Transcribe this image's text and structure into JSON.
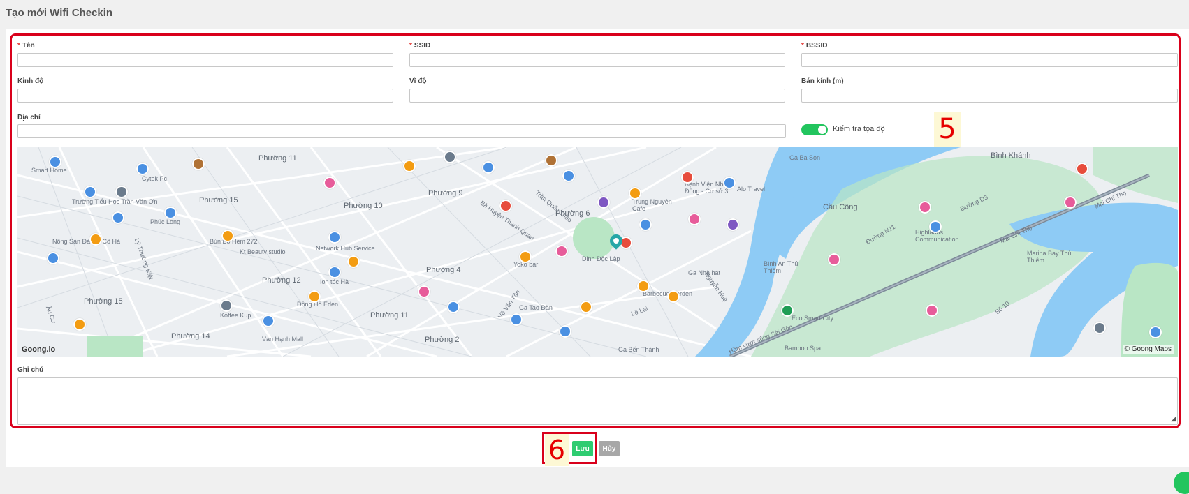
{
  "page": {
    "title": "Tạo mới Wifi Checkin"
  },
  "form": {
    "name_label": "Tên",
    "ssid_label": "SSID",
    "bssid_label": "BSSID",
    "longitude_label": "Kinh độ",
    "latitude_label": "Vĩ độ",
    "radius_label": "Bán kính (m)",
    "address_label": "Địa chỉ",
    "check_coords_label": "Kiểm tra tọa độ",
    "check_coords_enabled": true,
    "note_label": "Ghi chú"
  },
  "annotations": {
    "form_marker": "5",
    "save_marker": "6"
  },
  "map": {
    "attribution_left": "Goong.io",
    "attribution_right": "© Goong Maps",
    "labels": {
      "phuong11_top": "Phường 11",
      "phuong15_a": "Phường 15",
      "phuong10_a": "Phường 10",
      "phuong9": "Phường 9",
      "phuong6": "Phường 6",
      "phuong4": "Phường 4",
      "phuong12": "Phường 12",
      "phuong15_b": "Phường 15",
      "phuong11_b": "Phường 11",
      "phuong2": "Phường 2",
      "phuong14": "Phường 14",
      "cau_cong": "Cầu Công",
      "binh_khanh": "Bình Khánh",
      "dinh_doc_lap": "Dinh Độc Lập",
      "mai_chi_tho_a": "Mai Chí Thọ",
      "mai_chi_tho_b": "Mai Chí Thọ",
      "ham_vuot_song": "Hầm vượt sông Sài Gòn",
      "ly_thuong_kiet": "Lý Thường Kiệt",
      "nguyen_hue": "Nguyễn Huệ",
      "le_lai": "Lê Lai",
      "au_co": "Âu Cơ",
      "ba_huyen_thanh_quan": "Bà Huyện Thanh Quan",
      "tran_quoc_thao": "Trần Quốc Thảo",
      "vo_van_tan": "Võ Văn Tần",
      "duong_n11": "Đường N11",
      "duong_d3": "Đường D3",
      "so_10": "Số 10"
    },
    "places": {
      "smart_home": "Smart Home",
      "cytek": "Cytek Pc",
      "tieu_hoc": "Trường Tiểu Học Trần Văn Ơn",
      "phuc_long": "Phúc Long",
      "nong_san": "Nông Sản Đà Lạt Cô Hà",
      "bun_bo": "Bún Bò Hem 272",
      "kt_beauty": "Kt Beauty studio",
      "network_hub": "Network Hub Service",
      "ion_toc_ha": "Ion tóc Hà",
      "dong_ho_eden": "Đồng Hồ Eden",
      "kofee_kup": "Koffee Kup",
      "van_hanh_mall": "Vạn Hạnh Mall",
      "yoko_bar": "Yoko bar",
      "ga_tao_dan": "Ga Tao Đàn",
      "barbecue_garden": "Barbecue Garden",
      "ga_nha_hat": "Ga Nhà hát",
      "eco_smart_city": "Eco Smart City",
      "ga_ba_son": "Ga Ba Son",
      "bamboo_spa": "Bamboo Spa",
      "binh_an": "Bình An Thủ Thiêm",
      "hurricane": "Highlands Communication",
      "marina_bay": "Marina Bay Thủ Thiêm",
      "ga_ben_thanh": "Ga Bến Thành",
      "trung_nguyen": "Trung Nguyên Cafe",
      "benh_vien_nhi": "Bệnh Viện Nhi Đồng - Cơ sở 3",
      "alo_travel": "Alo Travel"
    }
  },
  "actions": {
    "save_label": "Lưu",
    "cancel_label": "Hủy"
  },
  "colors": {
    "primary_green": "#2ecc71",
    "annotation_red": "#d9001b",
    "river": "#8ecbf5",
    "park": "#b9e6c5"
  }
}
